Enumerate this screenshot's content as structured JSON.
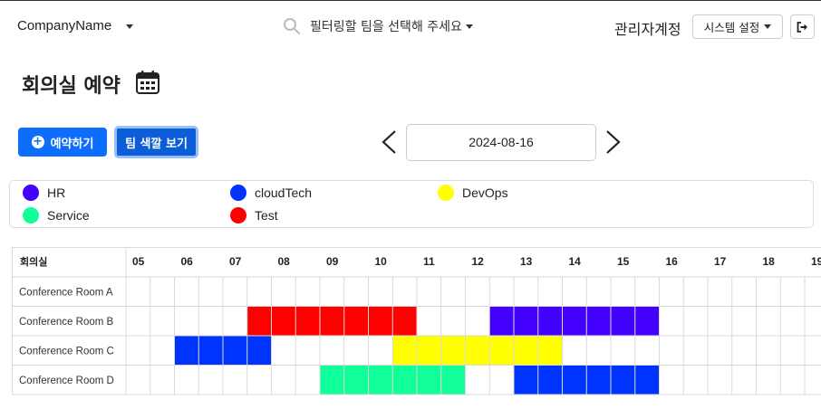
{
  "navbar": {
    "brand": "CompanyName",
    "team_filter_placeholder": "필터링할 팀을 선택해 주세요",
    "admin_label": "관리자계정",
    "settings_label": "시스템 설정"
  },
  "page": {
    "title": "회의실 예약",
    "reserve_button": "예약하기",
    "team_color_button": "팀 색깔 보기",
    "date": "2024-08-16"
  },
  "legend": [
    {
      "name": "HR",
      "color": "#4400ff"
    },
    {
      "name": "cloudTech",
      "color": "#0033ff"
    },
    {
      "name": "DevOps",
      "color": "#ffff00"
    },
    {
      "name": "Service",
      "color": "#11ff99"
    },
    {
      "name": "Test",
      "color": "#ff0000"
    }
  ],
  "schedule": {
    "room_header": "회의실",
    "hours": [
      "05",
      "06",
      "07",
      "08",
      "09",
      "10",
      "11",
      "12",
      "13",
      "14",
      "15",
      "16",
      "17",
      "18",
      "19"
    ],
    "rooms": [
      "Conference Room A",
      "Conference Room B",
      "Conference Room C",
      "Conference Room D"
    ],
    "bookings": [
      {
        "room": "Conference Room B",
        "team": "Test",
        "start": "07:30",
        "end": "11:00"
      },
      {
        "room": "Conference Room B",
        "team": "HR",
        "start": "12:30",
        "end": "16:00"
      },
      {
        "room": "Conference Room C",
        "team": "cloudTech",
        "start": "06:00",
        "end": "08:00"
      },
      {
        "room": "Conference Room C",
        "team": "DevOps",
        "start": "10:30",
        "end": "14:00"
      },
      {
        "room": "Conference Room D",
        "team": "Service",
        "start": "09:00",
        "end": "12:00"
      },
      {
        "room": "Conference Room D",
        "team": "cloudTech",
        "start": "13:00",
        "end": "16:00"
      }
    ]
  }
}
